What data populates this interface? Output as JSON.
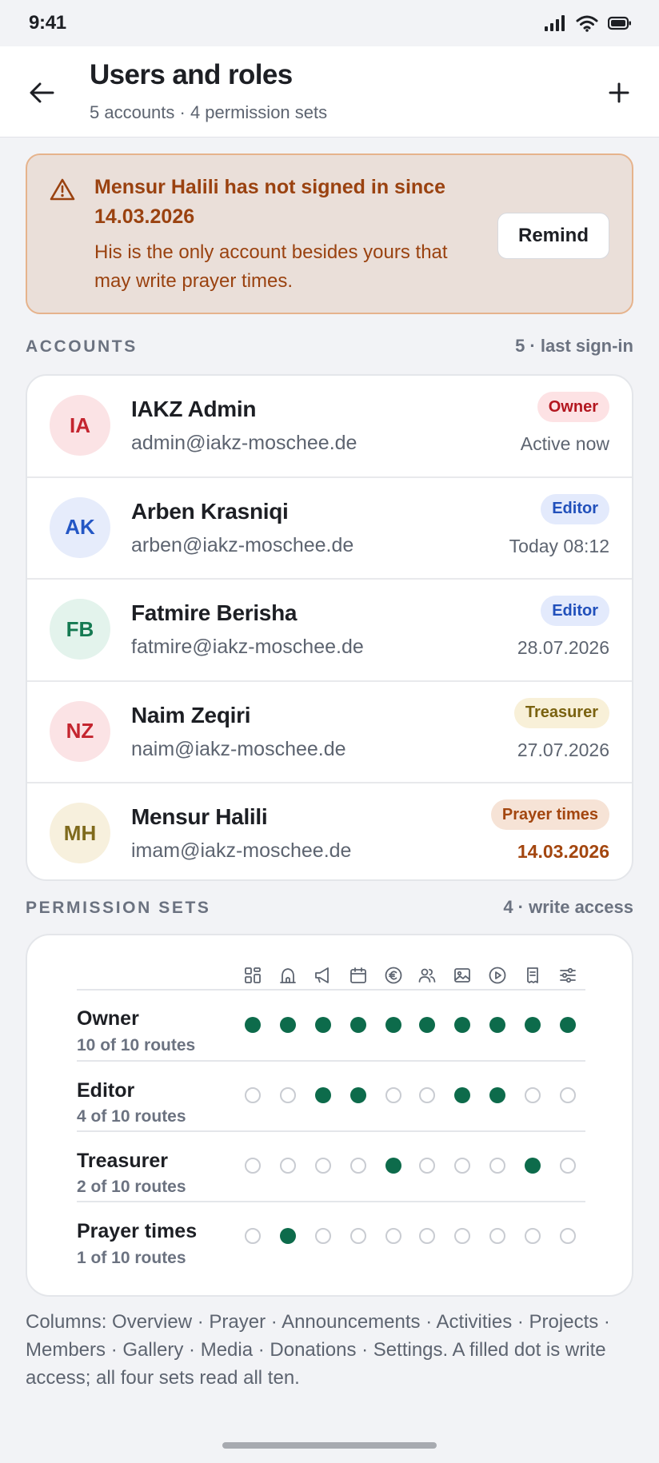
{
  "status_bar": {
    "time": "9:41"
  },
  "header": {
    "title": "Users and roles",
    "subtitle": "5 accounts · 4 permission sets",
    "back_icon": "arrow-left-icon",
    "add_icon": "plus-icon"
  },
  "alert": {
    "icon": "warning-triangle-icon",
    "title": "Mensur Halili has not signed in since 14.03.2026",
    "body": "His is the only account besides yours that may write prayer times.",
    "button_label": "Remind"
  },
  "accounts": {
    "label": "ACCOUNTS",
    "meta": "5 · last sign-in",
    "rows": [
      {
        "initials": "IA",
        "name": "IAKZ Admin",
        "email": "admin@iakz-moschee.de",
        "role": "Owner",
        "last": "Active now",
        "avatar_bg": "#fbe3e5",
        "avatar_fg": "#c4252f",
        "badge_bg": "#fde2e4",
        "badge_fg": "#b3161f",
        "last_warn": false
      },
      {
        "initials": "AK",
        "name": "Arben Krasniqi",
        "email": "arben@iakz-moschee.de",
        "role": "Editor",
        "last": "Today 08:12",
        "avatar_bg": "#e6ecfb",
        "avatar_fg": "#2457c5",
        "badge_bg": "#e3eafc",
        "badge_fg": "#2150bb",
        "last_warn": false
      },
      {
        "initials": "FB",
        "name": "Fatmire Berisha",
        "email": "fatmire@iakz-moschee.de",
        "role": "Editor",
        "last": "28.07.2026",
        "avatar_bg": "#e3f3ec",
        "avatar_fg": "#157a52",
        "badge_bg": "#e3eafc",
        "badge_fg": "#2150bb",
        "last_warn": false
      },
      {
        "initials": "NZ",
        "name": "Naim Zeqiri",
        "email": "naim@iakz-moschee.de",
        "role": "Treasurer",
        "last": "27.07.2026",
        "avatar_bg": "#fbe3e5",
        "avatar_fg": "#c4252f",
        "badge_bg": "#f8f0d8",
        "badge_fg": "#7a6210",
        "last_warn": false
      },
      {
        "initials": "MH",
        "name": "Mensur Halili",
        "email": "imam@iakz-moschee.de",
        "role": "Prayer times",
        "last": "14.03.2026",
        "avatar_bg": "#f7f0dd",
        "avatar_fg": "#7f6a1c",
        "badge_bg": "#f6e3d6",
        "badge_fg": "#a3460f",
        "last_warn": true
      }
    ]
  },
  "permissions": {
    "label": "PERMISSION SETS",
    "meta": "4 · write access",
    "column_icons": [
      "grid-icon",
      "mosque-icon",
      "megaphone-icon",
      "calendar-icon",
      "euro-icon",
      "users-icon",
      "image-icon",
      "play-icon",
      "receipt-icon",
      "sliders-icon"
    ],
    "sets": [
      {
        "name": "Owner",
        "count": "10 of 10 routes",
        "access": [
          1,
          1,
          1,
          1,
          1,
          1,
          1,
          1,
          1,
          1
        ]
      },
      {
        "name": "Editor",
        "count": "4 of 10 routes",
        "access": [
          0,
          0,
          1,
          1,
          0,
          0,
          1,
          1,
          0,
          0
        ]
      },
      {
        "name": "Treasurer",
        "count": "2 of 10 routes",
        "access": [
          0,
          0,
          0,
          0,
          1,
          0,
          0,
          0,
          1,
          0
        ]
      },
      {
        "name": "Prayer times",
        "count": "1 of 10 routes",
        "access": [
          0,
          1,
          0,
          0,
          0,
          0,
          0,
          0,
          0,
          0
        ]
      }
    ]
  },
  "footnote": "Columns: Overview · Prayer · Announcements · Activities · Projects · Members · Gallery · Media · Donations · Settings. A filled dot is write access; all four sets read all ten.",
  "colors": {
    "accent": "#0d6b4b",
    "warning_text": "#9a4210",
    "warning_bg": "#eadfd9"
  }
}
